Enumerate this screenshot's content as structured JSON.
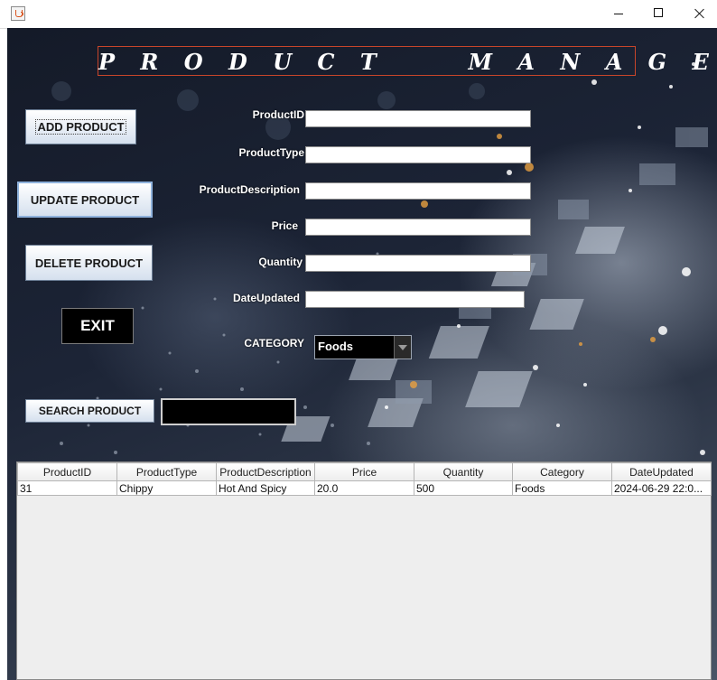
{
  "window": {
    "minimize_icon": "minimize-icon",
    "maximize_icon": "maximize-icon",
    "close_icon": "close-icon"
  },
  "header": {
    "title": "P R O D U C T     M A N A G E M E N T"
  },
  "actions": {
    "add": "ADD PRODUCT",
    "update": "UPDATE PRODUCT",
    "delete": "DELETE PRODUCT",
    "exit": "EXIT",
    "search": "SEARCH PRODUCT"
  },
  "form": {
    "product_id_label": "ProductID",
    "product_type_label": "ProductType",
    "product_description_label": "ProductDescription",
    "price_label": "Price",
    "quantity_label": "Quantity",
    "date_updated_label": "DateUpdated",
    "category_label": "CATEGORY",
    "category_value": "Foods"
  },
  "table": {
    "columns": [
      "ProductID",
      "ProductType",
      "ProductDescription",
      "Price",
      "Quantity",
      "Category",
      "DateUpdated"
    ],
    "rows": [
      [
        "31",
        "Chippy",
        "Hot And Spicy",
        "20.0",
        "500",
        "Foods",
        "2024-06-29 22:0..."
      ]
    ]
  }
}
